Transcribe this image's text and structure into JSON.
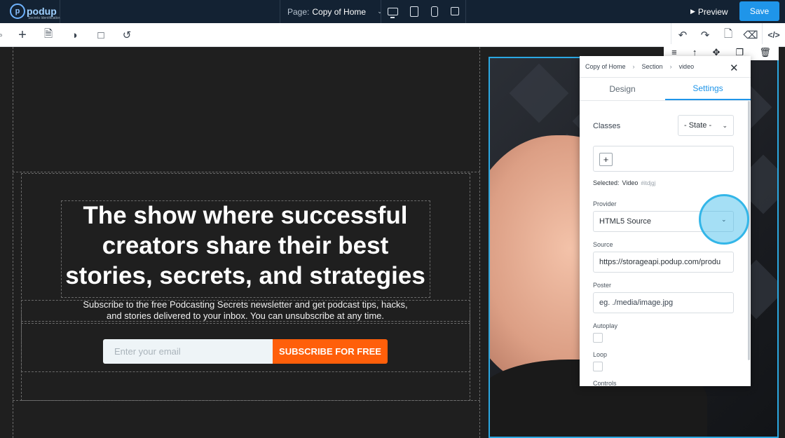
{
  "topbar": {
    "logo_text": "podup",
    "logo_sub": "Secrets Identification",
    "page_label": "Page:",
    "page_value": "Copy of Home",
    "preview_label": "Preview",
    "save_label": "Save"
  },
  "canvas": {
    "headline": "The show where successful creators share their best stories, secrets, and strategies",
    "subtext_line1": "Subscribe to the free Podcasting Secrets newsletter and get podcast tips, hacks,",
    "subtext_line2": "and stories delivered to your inbox. You can unsubscribe at any time.",
    "email_placeholder": "Enter your email",
    "subscribe_button": "SUBSCRIBE FOR FREE"
  },
  "panel": {
    "breadcrumb": [
      "Copy of Home",
      "Section",
      "video"
    ],
    "tabs": [
      "Design",
      "Settings"
    ],
    "active_tab": "Settings",
    "classes_label": "Classes",
    "state_label": "- State -",
    "selected_label": "Selected:",
    "selected_value": "Video",
    "selected_id": "#itdjgj",
    "provider_label": "Provider",
    "provider_value": "HTML5 Source",
    "source_label": "Source",
    "source_value": "https://storageapi.podup.com/produ",
    "poster_label": "Poster",
    "poster_placeholder": "eg. ./media/image.jpg",
    "autoplay_label": "Autoplay",
    "loop_label": "Loop",
    "controls_label": "Controls"
  },
  "colors": {
    "topbar_bg": "#132233",
    "save_accent": "#1f95e9",
    "subscribe_orange": "#ff5f0a",
    "selection_blue": "#2ba8e2",
    "canvas_bg": "#1f1f1f"
  }
}
